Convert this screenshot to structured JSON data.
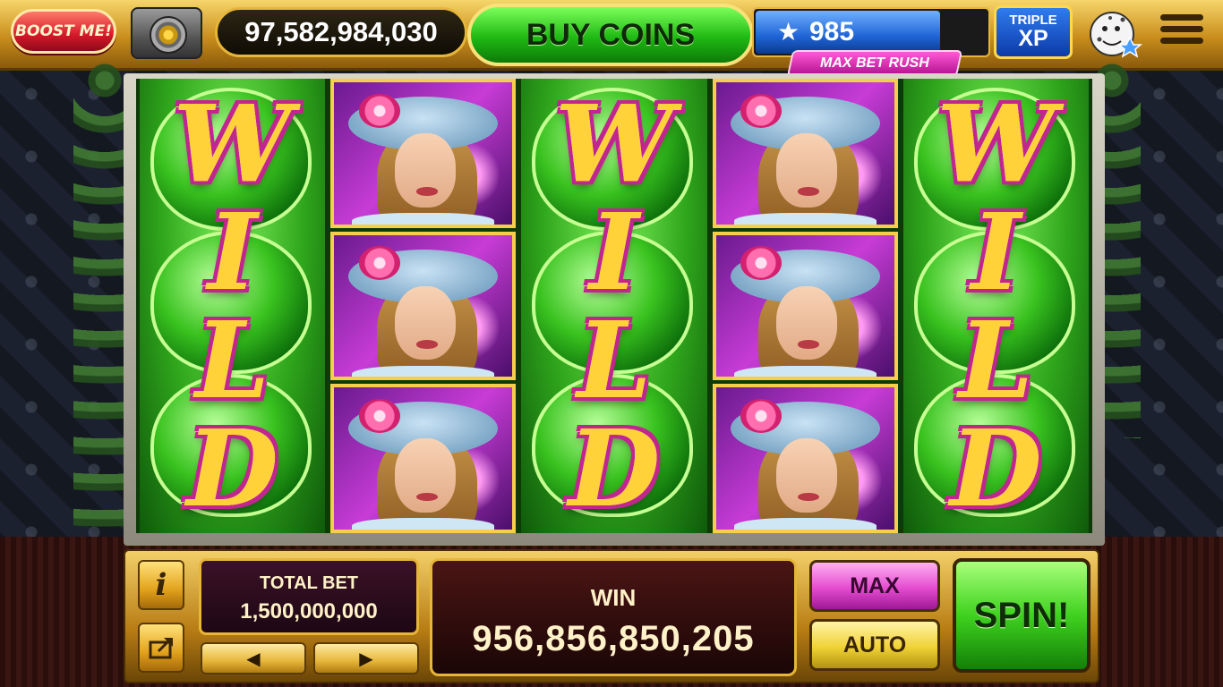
{
  "topbar": {
    "boost_label": "BOOST ME!",
    "balance": "97,582,984,030",
    "buy_label": "BUY COINS",
    "xp_level": "985",
    "xp_progress": 0.8,
    "rush_label": "MAX BET RUSH",
    "triple_line1": "TRIPLE",
    "triple_line2": "XP",
    "icons": {
      "vault": "vault-icon",
      "star": "star-icon",
      "mascot": "leopard-mascot-icon",
      "menu": "menu-icon"
    }
  },
  "reels": {
    "wild_letters": [
      "W",
      "I",
      "L",
      "D"
    ],
    "columns": [
      {
        "symbol": "WILD"
      },
      {
        "symbol": "lady-portrait"
      },
      {
        "symbol": "WILD"
      },
      {
        "symbol": "lady-portrait"
      },
      {
        "symbol": "WILD"
      }
    ]
  },
  "bottom": {
    "info_icon": "i",
    "total_bet_label": "TOTAL BET",
    "total_bet_value": "1,500,000,000",
    "arrow_left": "◀",
    "arrow_right": "▶",
    "win_label": "WIN",
    "win_value": "956,856,850,205",
    "max_label": "MAX",
    "auto_label": "AUTO",
    "spin_label": "SPIN!"
  },
  "colors": {
    "gold": "#e6b63a",
    "spin_green": "#3fd21f",
    "max_magenta": "#e44cd0",
    "boost_red": "#d4182a",
    "xp_blue": "#1f64d6"
  }
}
